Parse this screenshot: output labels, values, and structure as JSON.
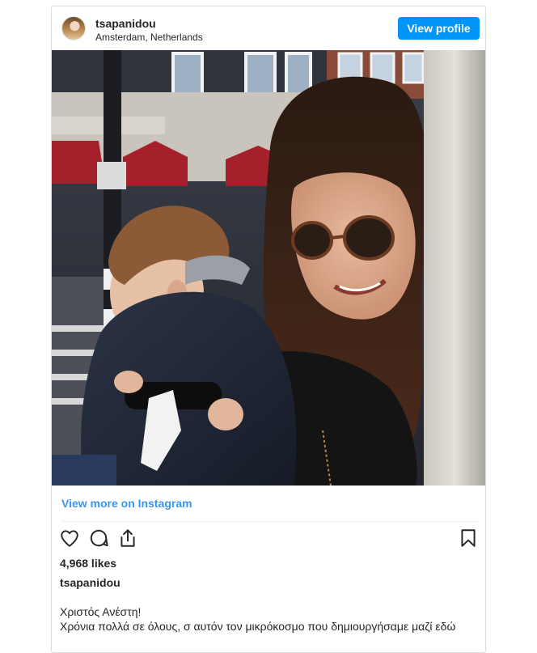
{
  "post": {
    "username": "tsapanidou",
    "location": "Amsterdam, Netherlands",
    "view_profile_label": "View profile",
    "view_more_label": "View more on Instagram",
    "likes": "4,968 likes",
    "caption_author": "tsapanidou",
    "caption_lines": [
      "Χριστός Ανέστη!",
      "Χρόνια πολλά σε όλους, σ αυτόν τον μικρόκοσμο που δημιουργήσαμε μαζί εδώ"
    ]
  },
  "icons": {
    "like": "heart-outline-icon",
    "comment": "speech-bubble-icon",
    "share": "share-arrow-icon",
    "save": "bookmark-outline-icon"
  },
  "colors": {
    "accent": "#0095f6",
    "link": "#3897f0",
    "text": "#262626",
    "border": "#dbdbdb"
  }
}
